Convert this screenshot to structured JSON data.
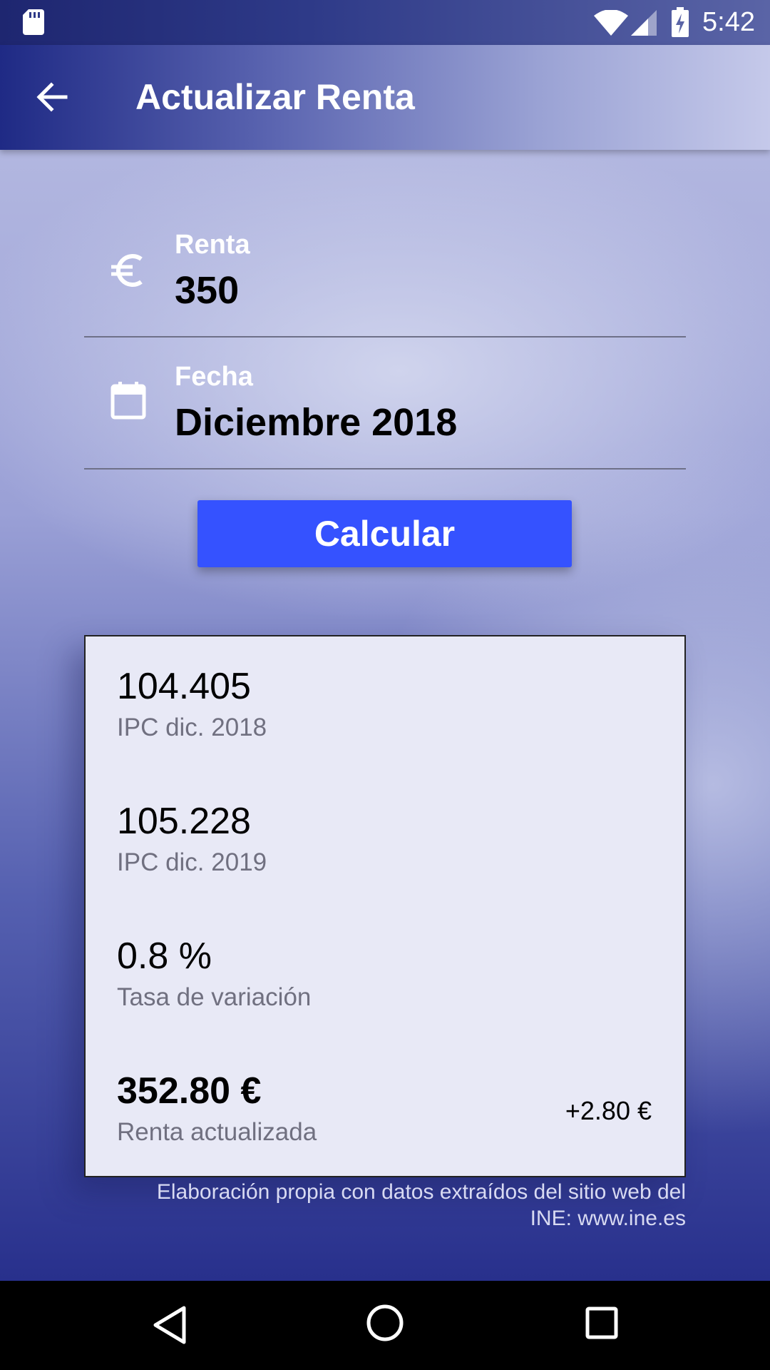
{
  "status_bar": {
    "time": "5:42",
    "icons": [
      "sd-card-icon",
      "wifi-icon",
      "cell-signal-icon",
      "battery-charging-icon"
    ]
  },
  "app_bar": {
    "title": "Actualizar Renta",
    "back_icon": "arrow-back-icon"
  },
  "form": {
    "renta": {
      "label": "Renta",
      "value": "350",
      "icon": "euro-icon"
    },
    "fecha": {
      "label": "Fecha",
      "value": "Diciembre 2018",
      "icon": "calendar-icon"
    },
    "calculate_label": "Calcular"
  },
  "results": {
    "ipc_start": {
      "value": "104.405",
      "label": "IPC dic. 2018"
    },
    "ipc_end": {
      "value": "105.228",
      "label": "IPC dic. 2019"
    },
    "rate": {
      "value": "0.8 %",
      "label": "Tasa de variación"
    },
    "updated_rent": {
      "value": "352.80 €",
      "label": "Renta actualizada",
      "difference": "+2.80 €"
    }
  },
  "source_note": {
    "line1": "Elaboración propia con datos extraídos del sitio web del",
    "line2": "INE: www.ine.es"
  },
  "colors": {
    "accent_button": "#3552ff",
    "app_bar_dark": "#1f2a85",
    "card_background": "#e8e9f6"
  },
  "nav_bar": {
    "icons": [
      "nav-back-icon",
      "nav-home-icon",
      "nav-recents-icon"
    ]
  }
}
